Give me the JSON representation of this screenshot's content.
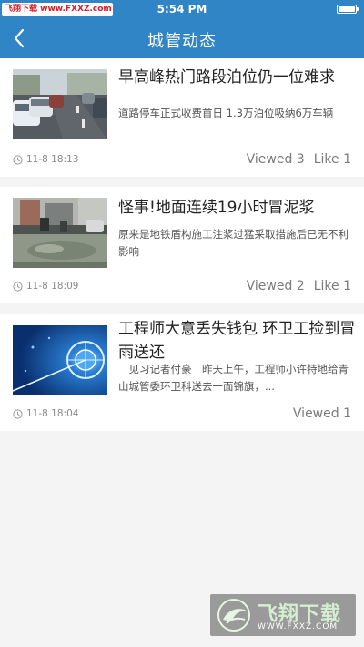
{
  "status_bar": {
    "time": "5:54 PM",
    "badge": "飞翔下载 www.FXXZ.com"
  },
  "nav": {
    "title": "城管动态",
    "back_icon": "chevron-left-icon"
  },
  "news": [
    {
      "title": "早高峰热门路段泊位仍一位难求",
      "summary": "道路停车正式收费首日 1.3万泊位吸纳6万车辆",
      "time": "11-8 18:13",
      "viewed": "Viewed 3",
      "like": "Like 1"
    },
    {
      "title": "怪事!地面连续19小时冒泥浆",
      "summary": "原来是地铁盾构施工注浆过猛采取措施后已无不利影响",
      "time": "11-8 18:09",
      "viewed": "Viewed 2",
      "like": "Like 1"
    },
    {
      "title": "工程师大意丢失钱包 环卫工捡到冒雨送还",
      "summary": "　见习记者付豪　昨天上午，工程师小许特地给青山城管委环卫科送去一面锦旗，...",
      "time": "11-8 18:04",
      "viewed": "Viewed 1",
      "like": ""
    }
  ],
  "watermark": {
    "text": "飞翔下载",
    "url": "WWW.FXXZ.COM"
  },
  "colors": {
    "accent": "#2f85c6",
    "background": "#f4f4f4"
  }
}
